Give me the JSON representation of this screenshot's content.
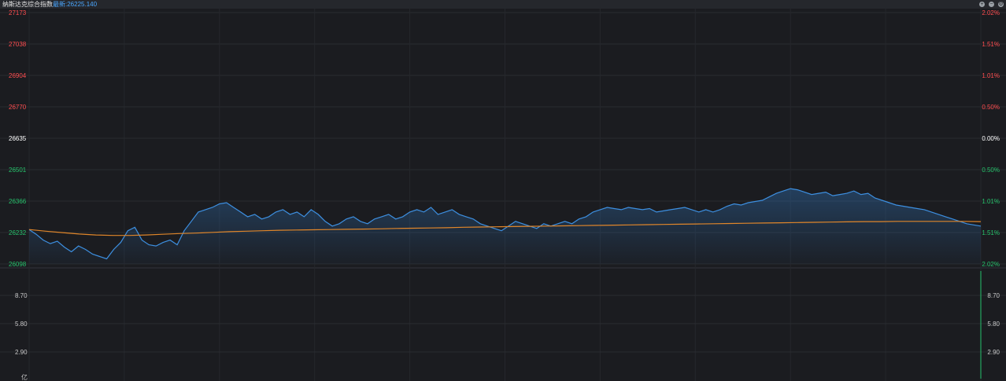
{
  "header": {
    "title": "纳斯达克综合指数",
    "latest_label": "最新:",
    "latest_value": "26225.140",
    "controls": [
      "plus-icon",
      "minus-icon",
      "gear-icon"
    ]
  },
  "colors": {
    "price_line": "#3d8fe0",
    "avg_line": "#e0862a",
    "up": "#ff4d4f",
    "down": "#26c26b",
    "flat": "#ffffff"
  },
  "price_axis": {
    "left": [
      "27173",
      "27038",
      "26904",
      "26770",
      "26635",
      "26501",
      "26366",
      "26232",
      "26098"
    ],
    "right": [
      "2.02%",
      "1.51%",
      "1.01%",
      "0.50%",
      "0.00%",
      "0.50%",
      "1.01%",
      "1.51%",
      "2.02%"
    ]
  },
  "volume_axis": {
    "left": [
      "8.70",
      "5.80",
      "2.90",
      "亿"
    ],
    "right": [
      "8.70",
      "5.80",
      "2.90"
    ]
  },
  "chart_data": {
    "type": "line",
    "title": "纳斯达克综合指数",
    "ylim": [
      26098,
      27173
    ],
    "ylim_pct": [
      -2.02,
      2.02
    ],
    "reference": 26635,
    "grid": true,
    "series": [
      {
        "y": [
          26245,
          26225,
          26200,
          26185,
          26195,
          26170,
          26150,
          26175,
          26160,
          26140,
          26130,
          26120,
          26160,
          26190,
          26240,
          26255,
          26200,
          26180,
          26175,
          26190,
          26200,
          26180,
          26240,
          26280,
          26320,
          26330,
          26340,
          26355,
          26360,
          26340,
          26320,
          26300,
          26310,
          26290,
          26300,
          26320,
          26330,
          26310,
          26320,
          26300,
          26330,
          26310,
          26280,
          26260,
          26270,
          26290,
          26300,
          26280,
          26270,
          26290,
          26300,
          26310,
          26290,
          26300,
          26320,
          26330,
          26320,
          26340,
          26310,
          26320,
          26330,
          26310,
          26300,
          26290,
          26270,
          26260,
          26250,
          26240,
          26260,
          26280,
          26270,
          26260,
          26250,
          26270,
          26260,
          26270,
          26280,
          26270,
          26290,
          26300,
          26320,
          26330,
          26340,
          26335,
          26330,
          26340,
          26335,
          26330,
          26335,
          26320,
          26325,
          26330,
          26335,
          26340,
          26330,
          26320,
          26330,
          26320,
          26330,
          26345,
          26355,
          26350,
          26360,
          26365,
          26370,
          26385,
          26400,
          26410,
          26420,
          26415,
          26405,
          26395,
          26400,
          26405,
          26390,
          26395,
          26400,
          26410,
          26395,
          26400,
          26380,
          26370,
          26360,
          26350,
          26345,
          26340,
          26335,
          26330,
          26320,
          26310,
          26300,
          26290,
          26280,
          26270,
          26265,
          26260
        ],
        "name": ""
      },
      {
        "y": [
          26245,
          26238,
          26232,
          26226,
          26222,
          26220,
          26220,
          26222,
          26225,
          26228,
          26230,
          26233,
          26236,
          26238,
          26240,
          26242,
          26243,
          26244,
          26245,
          26246,
          26247,
          26248,
          26250,
          26251,
          26252,
          26253,
          26255,
          26256,
          26257,
          26258,
          26259,
          26260,
          26261,
          26262,
          26263,
          26264,
          26265,
          26266,
          26267,
          26268,
          26269,
          26270,
          26271,
          26272,
          26273,
          26274,
          26275,
          26276,
          26277,
          26278,
          26279,
          26279,
          26280,
          26280,
          26280,
          26280,
          26280,
          26279
        ],
        "name": ""
      }
    ],
    "volume": {
      "ylim": [
        0,
        11.6
      ],
      "ticks": [
        "8.70",
        "5.80",
        "2.90"
      ],
      "unit": "亿"
    }
  }
}
